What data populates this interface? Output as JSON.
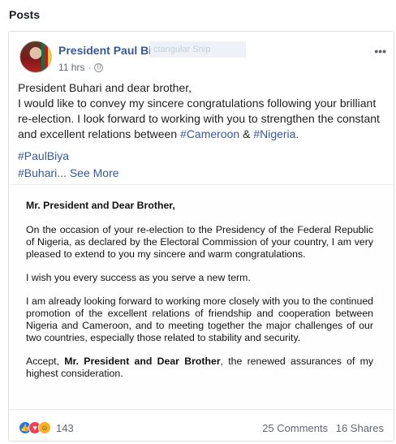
{
  "section": {
    "title": "Posts"
  },
  "post": {
    "author": "President Paul Biya",
    "snip_overlay": "ctangular Snip",
    "time": "11 hrs",
    "dot": "·",
    "more": "•••",
    "text_line1": "President Buhari and dear brother,",
    "text_body": "I would like to convey my sincere congratulations following your brilliant re-election. I look forward to working with you to strengthen the constant and excellent relations between ",
    "tag_cameroon": "#Cameroon",
    "amp": " & ",
    "tag_nigeria": "#Nigeria.",
    "hashtag1": "#PaulBiya",
    "hashtag2": "#Buhari...",
    "see_more": "See More"
  },
  "letter": {
    "greeting": "Mr. President and Dear Brother,",
    "para1": "On the occasion of your re-election to the Presidency of the Federal Republic of Nigeria, as declared by the Electoral Commission of your country, I am very pleased to extend to you my sincere and warm congratulations.",
    "para2": "I wish you every success as you serve a new term.",
    "para3": "I am already looking forward to working more closely with you to the continued promotion of the excellent relations of friendship and cooperation between Nigeria and Cameroon, and to meeting together the major challenges of our two countries, especially those related to stability and security.",
    "para4_start": "Accept, ",
    "para4_bold": "Mr. President and Dear Brother",
    "para4_end": ", the renewed assurances of my highest consideration."
  },
  "footer": {
    "reaction_icons": [
      "like-icon",
      "love-icon",
      "haha-icon"
    ],
    "reaction_count": "143",
    "comments": "25 Comments",
    "shares": "16 Shares"
  },
  "colors": {
    "link": "#385898",
    "muted": "#606770",
    "border": "#dddfe2"
  }
}
